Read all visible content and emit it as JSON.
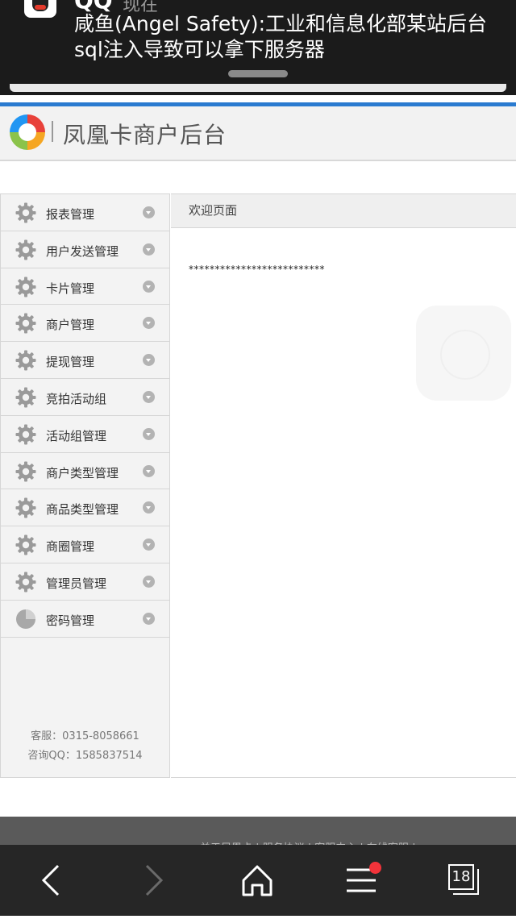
{
  "notification": {
    "app_name": "QQ",
    "time": "现在",
    "message": "咸鱼(Angel Safety):工业和信息化部某站后台sql注入导致可以拿下服务器"
  },
  "site": {
    "title": "凤凰卡商户后台"
  },
  "sidebar": {
    "items": [
      {
        "label": "报表管理",
        "icon": "gear-icon"
      },
      {
        "label": "用户发送管理",
        "icon": "gear-icon"
      },
      {
        "label": "卡片管理",
        "icon": "gear-icon"
      },
      {
        "label": "商户管理",
        "icon": "gear-icon"
      },
      {
        "label": "提现管理",
        "icon": "gear-icon"
      },
      {
        "label": "竞拍活动组",
        "icon": "gear-icon"
      },
      {
        "label": "活动组管理",
        "icon": "gear-icon"
      },
      {
        "label": "商户类型管理",
        "icon": "gear-icon"
      },
      {
        "label": "商品类型管理",
        "icon": "gear-icon"
      },
      {
        "label": "商圈管理",
        "icon": "gear-icon"
      },
      {
        "label": "管理员管理",
        "icon": "gear-icon"
      },
      {
        "label": "密码管理",
        "icon": "pie-icon"
      }
    ],
    "service_phone": "客服：0315-8058661",
    "service_qq": "咨询QQ：1585837514"
  },
  "main": {
    "tab_label": "欢迎页面",
    "content_text": "**************************"
  },
  "footer": {
    "links_text": "关于凤凰卡 | 服务协议 | 客服中心 | 在线客服 |"
  },
  "browser": {
    "tab_count": "18"
  },
  "colors": {
    "accent_blue": "#2a7bd0",
    "badge_red": "#f2333a"
  }
}
